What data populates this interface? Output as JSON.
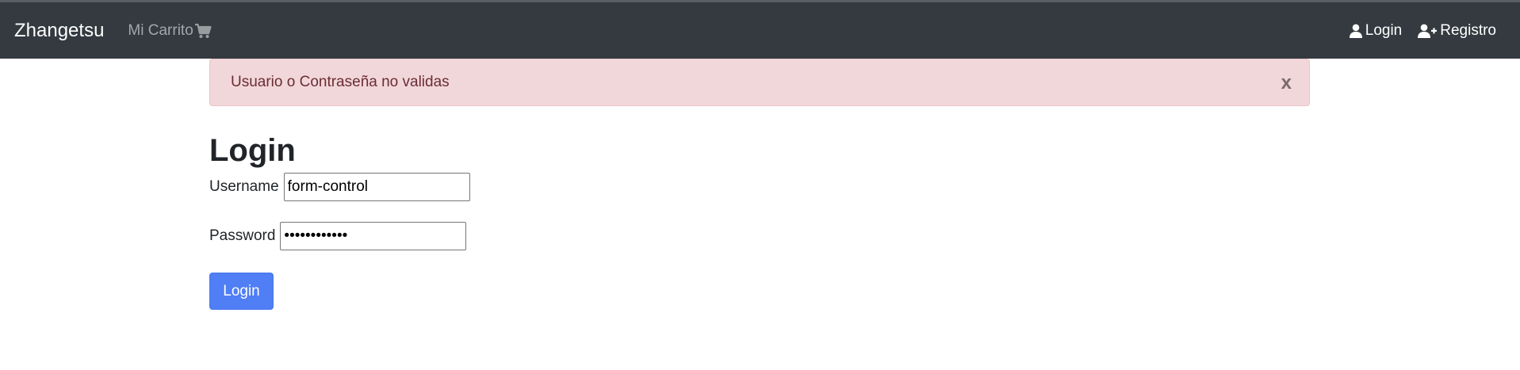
{
  "navbar": {
    "brand": "Zhangetsu",
    "cart_label": "Mi Carrito",
    "cart_icon": "shopping-cart-icon",
    "login_label": "Login",
    "login_icon": "user-icon",
    "register_label": "Registro",
    "register_icon": "user-plus-icon",
    "colors": {
      "background": "#343a40",
      "muted": "#9a9da0"
    }
  },
  "alert": {
    "message": "Usuario o Contraseña no validas",
    "close_label": "x",
    "colors": {
      "background": "#f2d7da",
      "text": "#6a2d33"
    }
  },
  "form": {
    "title": "Login",
    "username_label": "Username",
    "username_value": "form-control",
    "password_label": "Password",
    "password_value": "••••••••••••",
    "submit_label": "Login",
    "colors": {
      "button": "#4f7ef5"
    }
  }
}
